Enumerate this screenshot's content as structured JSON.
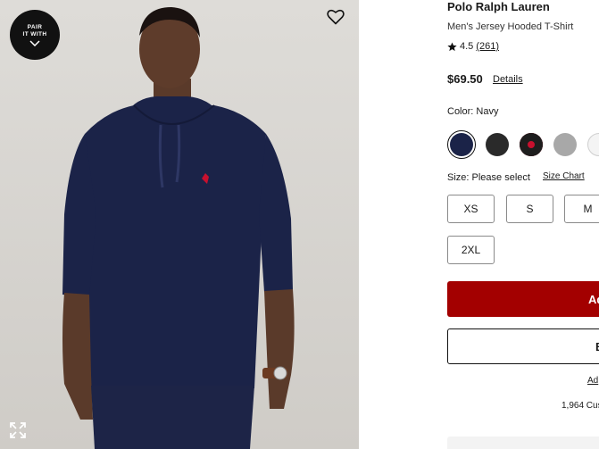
{
  "media": {
    "badge_line1": "PAIR",
    "badge_line2": "IT WITH",
    "icons": {
      "badge": "chevron-down-icon",
      "favorite": "heart-icon",
      "expand": "expand-icon"
    },
    "colors": {
      "background": "#d8d6d2",
      "shirt": "#1b2348",
      "logo": "#c8102e"
    }
  },
  "product": {
    "brand": "Polo Ralph Lauren",
    "name": "Men's Jersey Hooded T-Shirt",
    "rating_value": "4.5",
    "rating_count": "(261)",
    "price": "$69.50",
    "details_label": "Details"
  },
  "color": {
    "label": "Color: Navy",
    "swatches": [
      {
        "name": "navy",
        "color": "#1b2348",
        "selected": true
      },
      {
        "name": "black-pony",
        "color": "#2a2a2a",
        "selected": false
      },
      {
        "name": "black-red-pony",
        "color": "#1e1e1e",
        "selected": false
      },
      {
        "name": "grey-heather",
        "color": "#a8a8a8",
        "selected": false
      },
      {
        "name": "white",
        "color": "#f4f4f4",
        "selected": false
      }
    ]
  },
  "size": {
    "label": "Size: Please select",
    "chart_label": "Size Chart",
    "options": [
      "XS",
      "S",
      "M",
      "2XL"
    ]
  },
  "actions": {
    "add_label": "Ad",
    "secondary_label": "B",
    "small_link": "Ad",
    "customer_count": "1,964 Cus",
    "accent_color": "#a30000"
  }
}
